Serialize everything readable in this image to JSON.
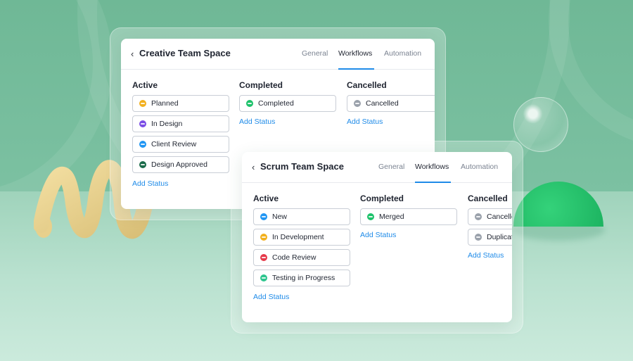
{
  "colors": {
    "accent": "#1f8be8",
    "yellow": "#f2b01e",
    "purple": "#7b4ee6",
    "blue": "#2196f3",
    "dark_green": "#1b6b4a",
    "green": "#1ec26b",
    "gray": "#9aa1ab",
    "red": "#e5394a",
    "teal": "#2ec58e"
  },
  "creative": {
    "back_icon": "chevron-left-icon",
    "title": "Creative Team Space",
    "tabs": [
      "General",
      "Workflows",
      "Automation"
    ],
    "active_tab": "Workflows",
    "columns": [
      {
        "heading": "Active",
        "statuses": [
          {
            "label": "Planned",
            "color": "#f2b01e"
          },
          {
            "label": "In Design",
            "color": "#7b4ee6"
          },
          {
            "label": "Client Review",
            "color": "#2196f3"
          },
          {
            "label": "Design Approved",
            "color": "#1b6b4a"
          }
        ],
        "add_label": "Add Status"
      },
      {
        "heading": "Completed",
        "statuses": [
          {
            "label": "Completed",
            "color": "#1ec26b"
          }
        ],
        "add_label": "Add Status"
      },
      {
        "heading": "Cancelled",
        "statuses": [
          {
            "label": "Cancelled",
            "color": "#9aa1ab"
          }
        ],
        "add_label": "Add Status"
      }
    ]
  },
  "scrum": {
    "back_icon": "chevron-left-icon",
    "title": "Scrum Team Space",
    "tabs": [
      "General",
      "Workflows",
      "Automation"
    ],
    "active_tab": "Workflows",
    "columns": [
      {
        "heading": "Active",
        "statuses": [
          {
            "label": "New",
            "color": "#2196f3"
          },
          {
            "label": "In Development",
            "color": "#f2b01e"
          },
          {
            "label": "Code Review",
            "color": "#e5394a"
          },
          {
            "label": "Testing in Progress",
            "color": "#2ec58e"
          }
        ],
        "add_label": "Add Status"
      },
      {
        "heading": "Completed",
        "statuses": [
          {
            "label": "Merged",
            "color": "#1ec26b"
          }
        ],
        "add_label": "Add Status"
      },
      {
        "heading": "Cancelled",
        "statuses": [
          {
            "label": "Cancelled",
            "color": "#9aa1ab"
          },
          {
            "label": "Duplicate",
            "color": "#9aa1ab"
          }
        ],
        "add_label": "Add Status"
      }
    ]
  }
}
